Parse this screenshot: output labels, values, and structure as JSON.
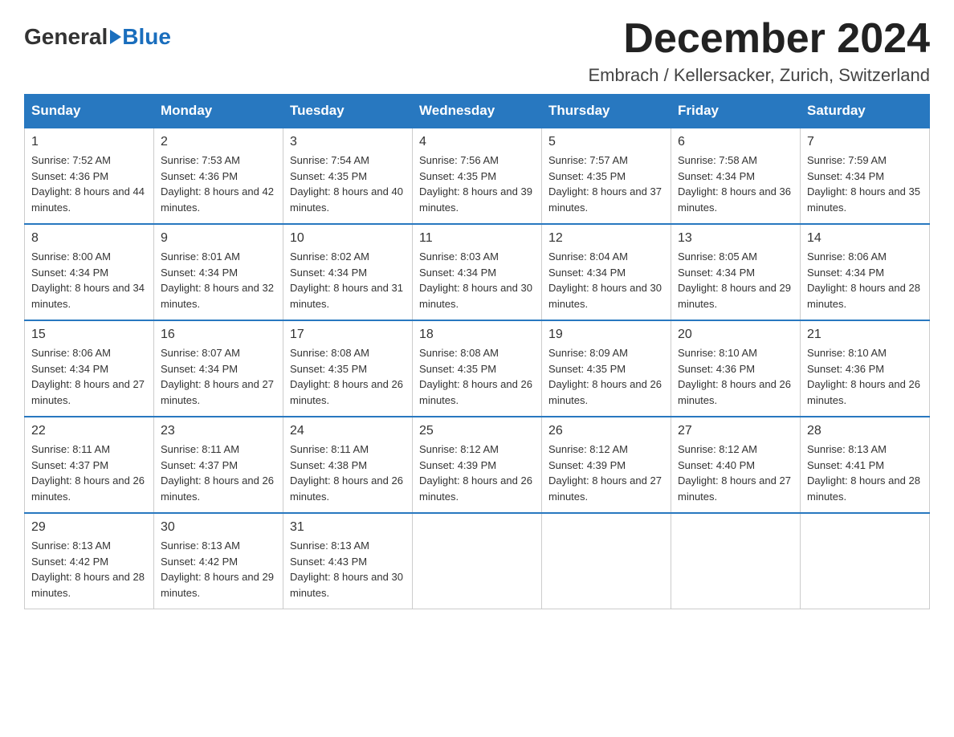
{
  "header": {
    "logo_general": "General",
    "logo_blue": "Blue",
    "month_title": "December 2024",
    "subtitle": "Embrach / Kellersacker, Zurich, Switzerland"
  },
  "days_of_week": [
    "Sunday",
    "Monday",
    "Tuesday",
    "Wednesday",
    "Thursday",
    "Friday",
    "Saturday"
  ],
  "weeks": [
    [
      {
        "day": "1",
        "sunrise": "7:52 AM",
        "sunset": "4:36 PM",
        "daylight": "8 hours and 44 minutes."
      },
      {
        "day": "2",
        "sunrise": "7:53 AM",
        "sunset": "4:36 PM",
        "daylight": "8 hours and 42 minutes."
      },
      {
        "day": "3",
        "sunrise": "7:54 AM",
        "sunset": "4:35 PM",
        "daylight": "8 hours and 40 minutes."
      },
      {
        "day": "4",
        "sunrise": "7:56 AM",
        "sunset": "4:35 PM",
        "daylight": "8 hours and 39 minutes."
      },
      {
        "day": "5",
        "sunrise": "7:57 AM",
        "sunset": "4:35 PM",
        "daylight": "8 hours and 37 minutes."
      },
      {
        "day": "6",
        "sunrise": "7:58 AM",
        "sunset": "4:34 PM",
        "daylight": "8 hours and 36 minutes."
      },
      {
        "day": "7",
        "sunrise": "7:59 AM",
        "sunset": "4:34 PM",
        "daylight": "8 hours and 35 minutes."
      }
    ],
    [
      {
        "day": "8",
        "sunrise": "8:00 AM",
        "sunset": "4:34 PM",
        "daylight": "8 hours and 34 minutes."
      },
      {
        "day": "9",
        "sunrise": "8:01 AM",
        "sunset": "4:34 PM",
        "daylight": "8 hours and 32 minutes."
      },
      {
        "day": "10",
        "sunrise": "8:02 AM",
        "sunset": "4:34 PM",
        "daylight": "8 hours and 31 minutes."
      },
      {
        "day": "11",
        "sunrise": "8:03 AM",
        "sunset": "4:34 PM",
        "daylight": "8 hours and 30 minutes."
      },
      {
        "day": "12",
        "sunrise": "8:04 AM",
        "sunset": "4:34 PM",
        "daylight": "8 hours and 30 minutes."
      },
      {
        "day": "13",
        "sunrise": "8:05 AM",
        "sunset": "4:34 PM",
        "daylight": "8 hours and 29 minutes."
      },
      {
        "day": "14",
        "sunrise": "8:06 AM",
        "sunset": "4:34 PM",
        "daylight": "8 hours and 28 minutes."
      }
    ],
    [
      {
        "day": "15",
        "sunrise": "8:06 AM",
        "sunset": "4:34 PM",
        "daylight": "8 hours and 27 minutes."
      },
      {
        "day": "16",
        "sunrise": "8:07 AM",
        "sunset": "4:34 PM",
        "daylight": "8 hours and 27 minutes."
      },
      {
        "day": "17",
        "sunrise": "8:08 AM",
        "sunset": "4:35 PM",
        "daylight": "8 hours and 26 minutes."
      },
      {
        "day": "18",
        "sunrise": "8:08 AM",
        "sunset": "4:35 PM",
        "daylight": "8 hours and 26 minutes."
      },
      {
        "day": "19",
        "sunrise": "8:09 AM",
        "sunset": "4:35 PM",
        "daylight": "8 hours and 26 minutes."
      },
      {
        "day": "20",
        "sunrise": "8:10 AM",
        "sunset": "4:36 PM",
        "daylight": "8 hours and 26 minutes."
      },
      {
        "day": "21",
        "sunrise": "8:10 AM",
        "sunset": "4:36 PM",
        "daylight": "8 hours and 26 minutes."
      }
    ],
    [
      {
        "day": "22",
        "sunrise": "8:11 AM",
        "sunset": "4:37 PM",
        "daylight": "8 hours and 26 minutes."
      },
      {
        "day": "23",
        "sunrise": "8:11 AM",
        "sunset": "4:37 PM",
        "daylight": "8 hours and 26 minutes."
      },
      {
        "day": "24",
        "sunrise": "8:11 AM",
        "sunset": "4:38 PM",
        "daylight": "8 hours and 26 minutes."
      },
      {
        "day": "25",
        "sunrise": "8:12 AM",
        "sunset": "4:39 PM",
        "daylight": "8 hours and 26 minutes."
      },
      {
        "day": "26",
        "sunrise": "8:12 AM",
        "sunset": "4:39 PM",
        "daylight": "8 hours and 27 minutes."
      },
      {
        "day": "27",
        "sunrise": "8:12 AM",
        "sunset": "4:40 PM",
        "daylight": "8 hours and 27 minutes."
      },
      {
        "day": "28",
        "sunrise": "8:13 AM",
        "sunset": "4:41 PM",
        "daylight": "8 hours and 28 minutes."
      }
    ],
    [
      {
        "day": "29",
        "sunrise": "8:13 AM",
        "sunset": "4:42 PM",
        "daylight": "8 hours and 28 minutes."
      },
      {
        "day": "30",
        "sunrise": "8:13 AM",
        "sunset": "4:42 PM",
        "daylight": "8 hours and 29 minutes."
      },
      {
        "day": "31",
        "sunrise": "8:13 AM",
        "sunset": "4:43 PM",
        "daylight": "8 hours and 30 minutes."
      },
      null,
      null,
      null,
      null
    ]
  ]
}
